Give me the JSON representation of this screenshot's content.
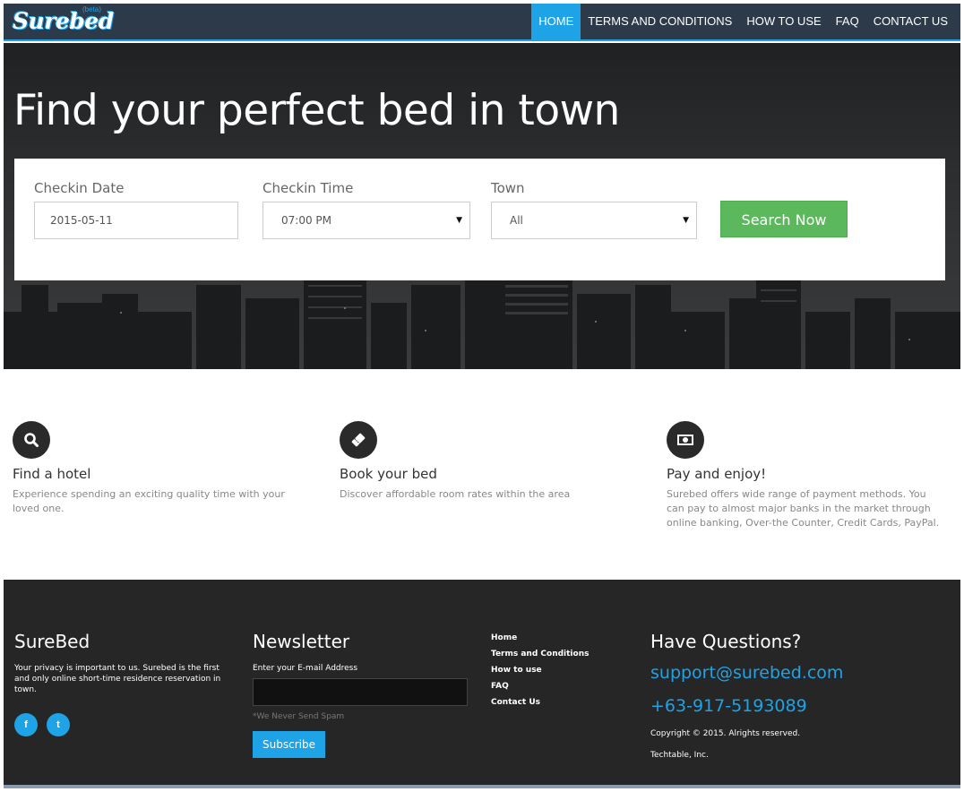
{
  "brand": {
    "logo_text": "Surebed",
    "beta": "(beta)"
  },
  "nav": {
    "items": [
      {
        "label": "HOME",
        "active": true
      },
      {
        "label": "TERMS AND CONDITIONS",
        "active": false
      },
      {
        "label": "HOW TO USE",
        "active": false
      },
      {
        "label": "FAQ",
        "active": false
      },
      {
        "label": "CONTACT US",
        "active": false
      }
    ]
  },
  "hero": {
    "title": "Find your perfect bed in town"
  },
  "search": {
    "checkin_date": {
      "label": "Checkin Date",
      "value": "2015-05-11"
    },
    "checkin_time": {
      "label": "Checkin Time",
      "value": "07:00 PM"
    },
    "town": {
      "label": "Town",
      "value": "All"
    },
    "button": "Search Now"
  },
  "features": [
    {
      "icon": "search-icon",
      "title": "Find a hotel",
      "desc": "Experience spending an exciting quality time with your loved one."
    },
    {
      "icon": "ticket-icon",
      "title": "Book your bed",
      "desc": "Discover affordable room rates within the area"
    },
    {
      "icon": "money-icon",
      "title": "Pay and enjoy!",
      "desc": "Surebed offers wide range of payment methods. You can pay to almost major banks in the market through online banking, Over-the Counter, Credit Cards, PayPal."
    }
  ],
  "footer": {
    "about": {
      "title": "SureBed",
      "text": "Your privacy is important to us. Surebed is the first and only online short-time residence reservation in town.",
      "social": {
        "facebook": "f",
        "twitter": "t"
      }
    },
    "newsletter": {
      "title": "Newsletter",
      "label": "Enter your E-mail Address",
      "note": "*We Never Send Spam",
      "button": "Subscribe"
    },
    "links": [
      "Home",
      "Terms and Conditions",
      "How to use",
      "FAQ",
      "Contact Us"
    ],
    "contact": {
      "title": "Have Questions?",
      "email": "support@surebed.com",
      "phone": "+63-917-5193089",
      "copyright": "Copyright © 2015. Alrights reserved.",
      "company": "Techtable, Inc."
    }
  },
  "colors": {
    "accent": "#1ea3e6",
    "nav_bg": "#2c3a4a",
    "button_green": "#5cb85c",
    "footer_bg": "#262626"
  }
}
